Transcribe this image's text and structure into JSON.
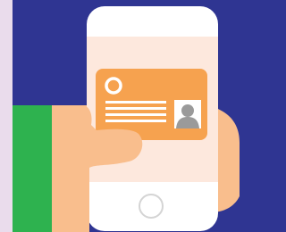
{
  "scene": {
    "colors": {
      "background_navy": "#2f3592",
      "left_strip_lilac": "#eadcec",
      "sleeve_green": "#2eb24f",
      "skin": "#f9be8d",
      "skin_shadow": "#f2ae7a",
      "phone_body": "#ffffff",
      "phone_screen": "#fde8dd",
      "id_card": "#f6a24f",
      "card_details": "#ffffff",
      "avatar_gray": "#9a9a9a",
      "home_button_ring": "#d4d4d4"
    },
    "icons": {
      "hand": "hand-holding-phone-icon",
      "phone": "smartphone-icon",
      "card": "id-card-icon",
      "avatar": "person-avatar-icon",
      "home": "home-button-icon"
    }
  }
}
